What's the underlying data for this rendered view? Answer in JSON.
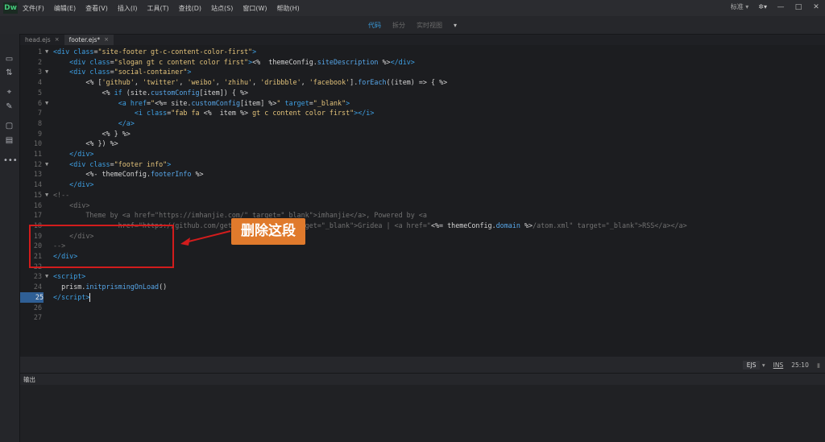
{
  "app": {
    "logo": "Dw"
  },
  "menu": [
    "文件(F)",
    "编辑(E)",
    "查看(V)",
    "插入(I)",
    "工具(T)",
    "查找(D)",
    "站点(S)",
    "窗口(W)",
    "帮助(H)"
  ],
  "menubar_right": {
    "layout": "标准",
    "win_min": "—",
    "win_max": "□",
    "win_close": "✕"
  },
  "view_tabs": [
    {
      "label": "代码",
      "active": true
    },
    {
      "label": "拆分",
      "active": false
    },
    {
      "label": "实时视图",
      "active": false
    }
  ],
  "doc_tabs": [
    {
      "label": "head.ejs",
      "close": "×",
      "active": false
    },
    {
      "label": "footer.ejs*",
      "close": "×",
      "active": true
    }
  ],
  "code_lines": [
    {
      "n": "1",
      "fold": "▼",
      "html": "<span class=\"tg\">&lt;div</span> <span class=\"at\">class</span>=<span class=\"st\">\"site-footer gt-c-content-color-first\"</span><span class=\"tg\">&gt;</span>"
    },
    {
      "n": "2",
      "fold": "",
      "html": "    <span class=\"tg\">&lt;div</span> <span class=\"at\">class</span>=<span class=\"st\">\"slogan gt c content color first\"</span><span class=\"tg\">&gt;</span>&lt;%  themeConfig.<span class=\"jsfn\">siteDescription</span> %&gt;<span class=\"tg\">&lt;/div&gt;</span>"
    },
    {
      "n": "3",
      "fold": "▼",
      "html": "    <span class=\"tg\">&lt;div</span> <span class=\"at\">class</span>=<span class=\"st\">\"social-container\"</span><span class=\"tg\">&gt;</span>"
    },
    {
      "n": "4",
      "fold": "",
      "html": "        &lt;% [<span class=\"jsstr\">'github'</span>, <span class=\"jsstr\">'twitter'</span>, <span class=\"jsstr\">'weibo'</span>, <span class=\"jsstr\">'zhihu'</span>, <span class=\"jsstr\">'dribbble'</span>, <span class=\"jsstr\">'facebook'</span>].<span class=\"jsfn\">forEach</span>((item) =&gt; { %&gt;"
    },
    {
      "n": "5",
      "fold": "",
      "html": "            &lt;% <span class=\"at\">if</span> (site.<span class=\"jsfn\">customConfig</span>[item]) { %&gt;"
    },
    {
      "n": "6",
      "fold": "▼",
      "html": "                <span class=\"tg\">&lt;a</span> <span class=\"at\">href</span>=<span class=\"st\">\"</span>&lt;%= site.<span class=\"jsfn\">customConfig</span>[item] %&gt;<span class=\"st\">\"</span> <span class=\"at\">target</span>=<span class=\"st\">\"_blank\"</span><span class=\"tg\">&gt;</span>"
    },
    {
      "n": "7",
      "fold": "",
      "html": "                    <span class=\"tg\">&lt;i</span> <span class=\"at\">class</span>=<span class=\"st\">\"fab fa </span>&lt;%  item %&gt;<span class=\"st\"> gt c content color first\"</span><span class=\"tg\">&gt;&lt;/i&gt;</span>"
    },
    {
      "n": "8",
      "fold": "",
      "html": "                <span class=\"tg\">&lt;/a&gt;</span>"
    },
    {
      "n": "9",
      "fold": "",
      "html": "            &lt;% } %&gt;"
    },
    {
      "n": "10",
      "fold": "",
      "html": "        &lt;% }) %&gt;"
    },
    {
      "n": "11",
      "fold": "",
      "html": "    <span class=\"tg\">&lt;/div&gt;</span>"
    },
    {
      "n": "12",
      "fold": "▼",
      "html": "    <span class=\"tg\">&lt;div</span> <span class=\"at\">class</span>=<span class=\"st\">\"footer info\"</span><span class=\"tg\">&gt;</span>"
    },
    {
      "n": "13",
      "fold": "",
      "html": "        &lt;%- themeConfig.<span class=\"jsfn\">footerInfo</span> %&gt;"
    },
    {
      "n": "14",
      "fold": "",
      "html": "    <span class=\"tg\">&lt;/div&gt;</span>"
    },
    {
      "n": "15",
      "fold": "▼",
      "html": "<span class=\"cm\">&lt;!--</span>"
    },
    {
      "n": "16",
      "fold": "",
      "html": "<span class=\"cm\">    &lt;div&gt;</span>"
    },
    {
      "n": "17",
      "fold": "",
      "html": "<span class=\"cm\">        Theme by &lt;a href=\"https://imhanjie.com/\" target=\"_blank\"&gt;imhanjie&lt;/a&gt;, Powered by &lt;a</span>"
    },
    {
      "n": "18",
      "fold": "",
      "html": "<span class=\"cm\">                href=\"https://github.com/getgridea/gridea\" target=\"_blank\"&gt;Gridea | &lt;a href=\"</span>&lt;%= themeConfig.<span class=\"jsfn\">domain</span> %&gt;<span class=\"cm\">/atom.xml\" target=\"_blank\"&gt;RSS&lt;/a&gt;&lt;/a&gt;</span>"
    },
    {
      "n": "19",
      "fold": "",
      "html": "<span class=\"cm\">    &lt;/div&gt;</span>"
    },
    {
      "n": "20",
      "fold": "",
      "html": "<span class=\"cm\">--&gt;</span>"
    },
    {
      "n": "21",
      "fold": "",
      "html": "<span class=\"tg\">&lt;/div&gt;</span>"
    },
    {
      "n": "22",
      "fold": "",
      "html": ""
    },
    {
      "n": "23",
      "fold": "▼",
      "html": "<span class=\"tg\">&lt;script&gt;</span>"
    },
    {
      "n": "24",
      "fold": "",
      "html": "  prism.<span class=\"jsfn\">initprismingOnLoad</span>()"
    },
    {
      "n": "25",
      "fold": "",
      "html": "<span class=\"tg\">&lt;/script&gt;</span><span class=\"caret\"></span>",
      "current": true
    },
    {
      "n": "26",
      "fold": "",
      "html": ""
    },
    {
      "n": "27",
      "fold": "",
      "html": ""
    }
  ],
  "callout": {
    "text": "删除这段",
    "color": "#e07a2c",
    "box_color": "#d21c1c"
  },
  "status": {
    "language": "EJS",
    "ins": "INS",
    "position": "25:10"
  },
  "output_panel": {
    "title": "输出"
  }
}
